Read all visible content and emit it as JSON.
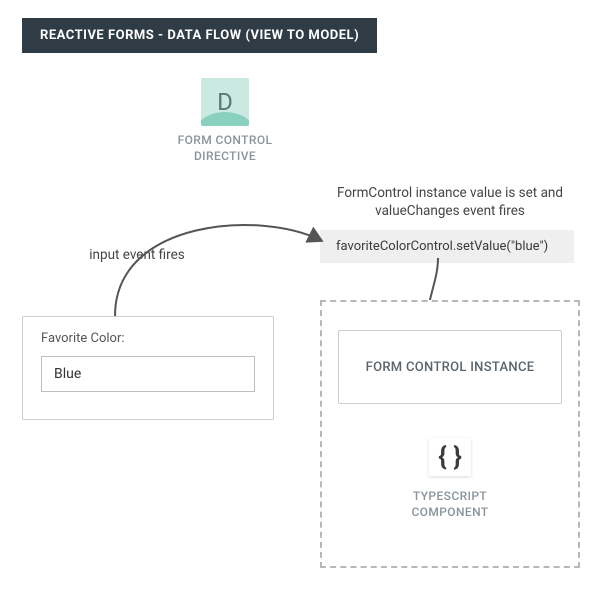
{
  "title": "REACTIVE FORMS - DATA FLOW (VIEW TO MODEL)",
  "directive": {
    "badge_letter": "D",
    "label_line1": "FORM CONTROL",
    "label_line2": "DIRECTIVE"
  },
  "captions": {
    "right": "FormControl instance value is set and valueChanges event fires",
    "left": "input event fires"
  },
  "code_chip": "favoriteColorControl.setValue(\"blue\")",
  "input_card": {
    "label": "Favorite Color:",
    "value": "Blue"
  },
  "ts_panel": {
    "instance_label": "FORM CONTROL INSTANCE",
    "braces": "{ }",
    "label_line1": "TYPESCRIPT",
    "label_line2": "COMPONENT"
  }
}
